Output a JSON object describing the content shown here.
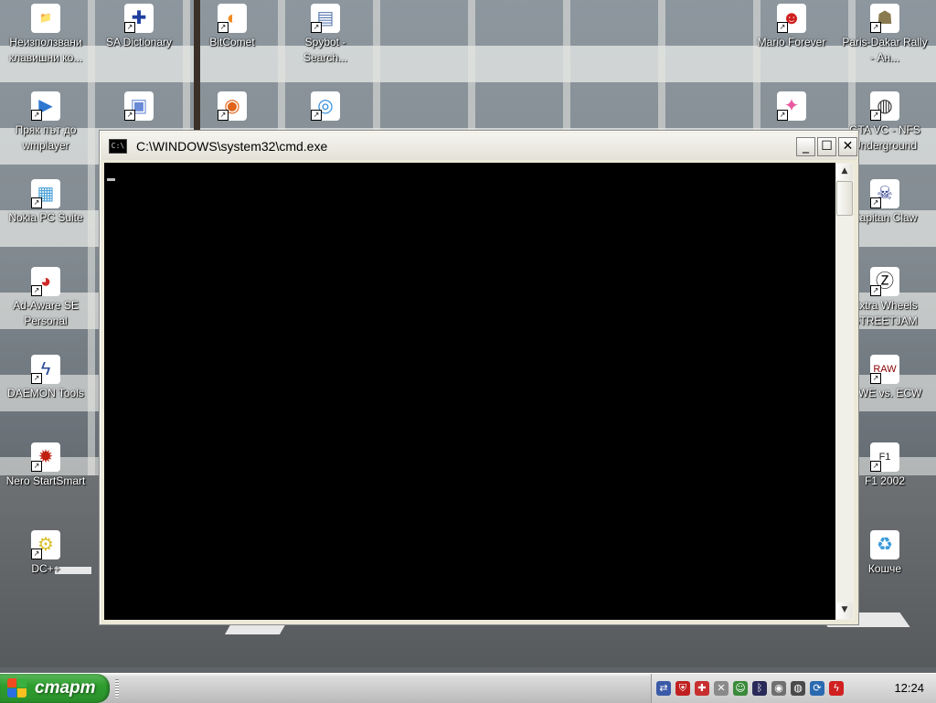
{
  "desktop": {
    "icons": [
      {
        "label": "Неизползвани клавишни ко...",
        "glyph": "📁",
        "color": "#e8c84a"
      },
      {
        "label": "SA Dictionary",
        "glyph": "✚",
        "color": "#1f3f9e"
      },
      {
        "label": "BitComet",
        "glyph": "◐",
        "color": "#f08a20"
      },
      {
        "label": "Spybot - Search...",
        "glyph": "▤",
        "color": "#5a7ab0"
      },
      {
        "label": "Mario Forever",
        "glyph": "☻",
        "color": "#d02020"
      },
      {
        "label": "Paris-Dakar Rally - Ан...",
        "glyph": "☗",
        "color": "#8a7a50"
      },
      {
        "label": "Пряк път до wmplayer",
        "glyph": "▶",
        "color": "#2e78d0"
      },
      {
        "label": "",
        "glyph": "▣",
        "color": "#6a8ad8"
      },
      {
        "label": "",
        "glyph": "◉",
        "color": "#e0641a"
      },
      {
        "label": "",
        "glyph": "◎",
        "color": "#2e8ad8"
      },
      {
        "label": "",
        "glyph": "✦",
        "color": "#e85aa0"
      },
      {
        "label": "GTA VC - NFS Underground",
        "glyph": "◍",
        "color": "#333333"
      },
      {
        "label": "Nokia PC Suite",
        "glyph": "▦",
        "color": "#4aa0d8"
      },
      {
        "label": "Kapitan Claw",
        "glyph": "☠",
        "color": "#2a3a8a"
      },
      {
        "label": "Ad-Aware SE Personal",
        "glyph": "◕",
        "color": "#d02828"
      },
      {
        "label": "Extra Wheels STREETJAM",
        "glyph": "Ⓩ",
        "color": "#111111"
      },
      {
        "label": "DAEMON Tools",
        "glyph": "ϟ",
        "color": "#2a4a9a"
      },
      {
        "label": "WWE vs. ECW",
        "glyph": "RAW",
        "color": "#8a0000"
      },
      {
        "label": "Nero StartSmart",
        "glyph": "✹",
        "color": "#c02010"
      },
      {
        "label": "F1 2002",
        "glyph": "F1",
        "color": "#222222"
      },
      {
        "label": "DC++",
        "glyph": "⚙",
        "color": "#d8c030"
      },
      {
        "label": "Кошче",
        "glyph": "♻",
        "color": "#3a9ad8"
      }
    ]
  },
  "window": {
    "title": "C:\\WINDOWS\\system32\\cmd.exe",
    "icon_text": "C:\\",
    "minimize": "_",
    "maximize": "☐",
    "close": "✕",
    "scroll_up": "▲",
    "scroll_down": "▼"
  },
  "taskbar": {
    "start_label": "старт",
    "clock": "12:24",
    "tray_icons": [
      {
        "name": "network-icon",
        "glyph": "⇄",
        "color": "#3a5aa8"
      },
      {
        "name": "shield-icon",
        "glyph": "⛨",
        "color": "#c02020"
      },
      {
        "name": "antivirus-icon",
        "glyph": "✚",
        "color": "#c83030"
      },
      {
        "name": "connection-off-icon",
        "glyph": "✕",
        "color": "#8a8a8a"
      },
      {
        "name": "users-icon",
        "glyph": "☺",
        "color": "#3a8a3a"
      },
      {
        "name": "bluetooth-icon",
        "glyph": "ᛒ",
        "color": "#2a2a5a"
      },
      {
        "name": "disc-icon",
        "glyph": "◉",
        "color": "#707070"
      },
      {
        "name": "speaker-icon",
        "glyph": "◍",
        "color": "#4a4a4a"
      },
      {
        "name": "update-icon",
        "glyph": "⟳",
        "color": "#2a6ab0"
      },
      {
        "name": "flash-icon",
        "glyph": "ϟ",
        "color": "#d02020"
      }
    ]
  }
}
